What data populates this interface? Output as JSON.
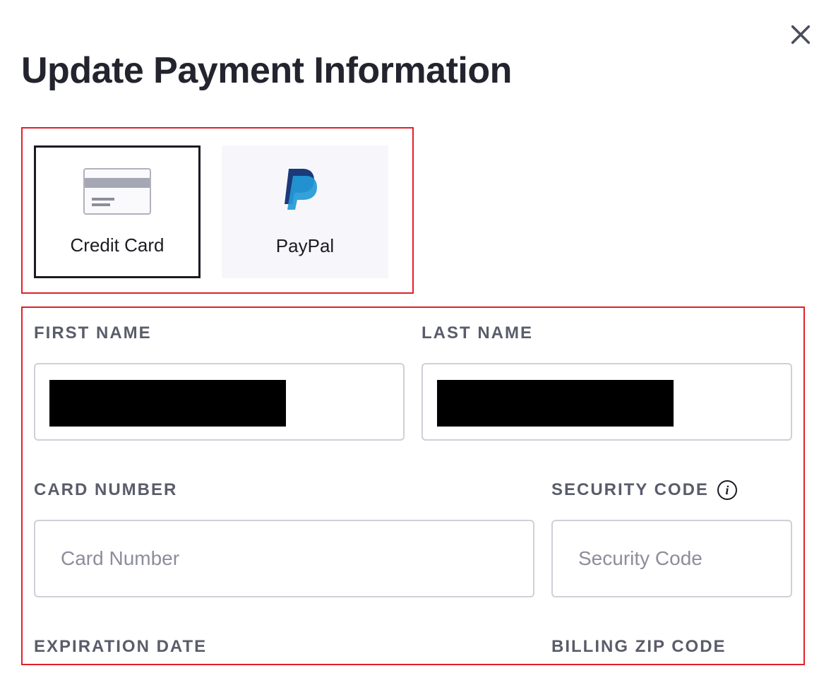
{
  "modal": {
    "title": "Update Payment Information"
  },
  "paymentMethods": {
    "creditCard": {
      "label": "Credit Card"
    },
    "paypal": {
      "label": "PayPal"
    }
  },
  "form": {
    "firstName": {
      "label": "First Name"
    },
    "lastName": {
      "label": "Last Name"
    },
    "cardNumber": {
      "label": "Card Number",
      "placeholder": "Card Number"
    },
    "securityCode": {
      "label": "Security Code",
      "placeholder": "Security Code"
    },
    "expiration": {
      "label": "Expiration Date"
    },
    "billingZip": {
      "label": "Billing Zip Code"
    }
  }
}
